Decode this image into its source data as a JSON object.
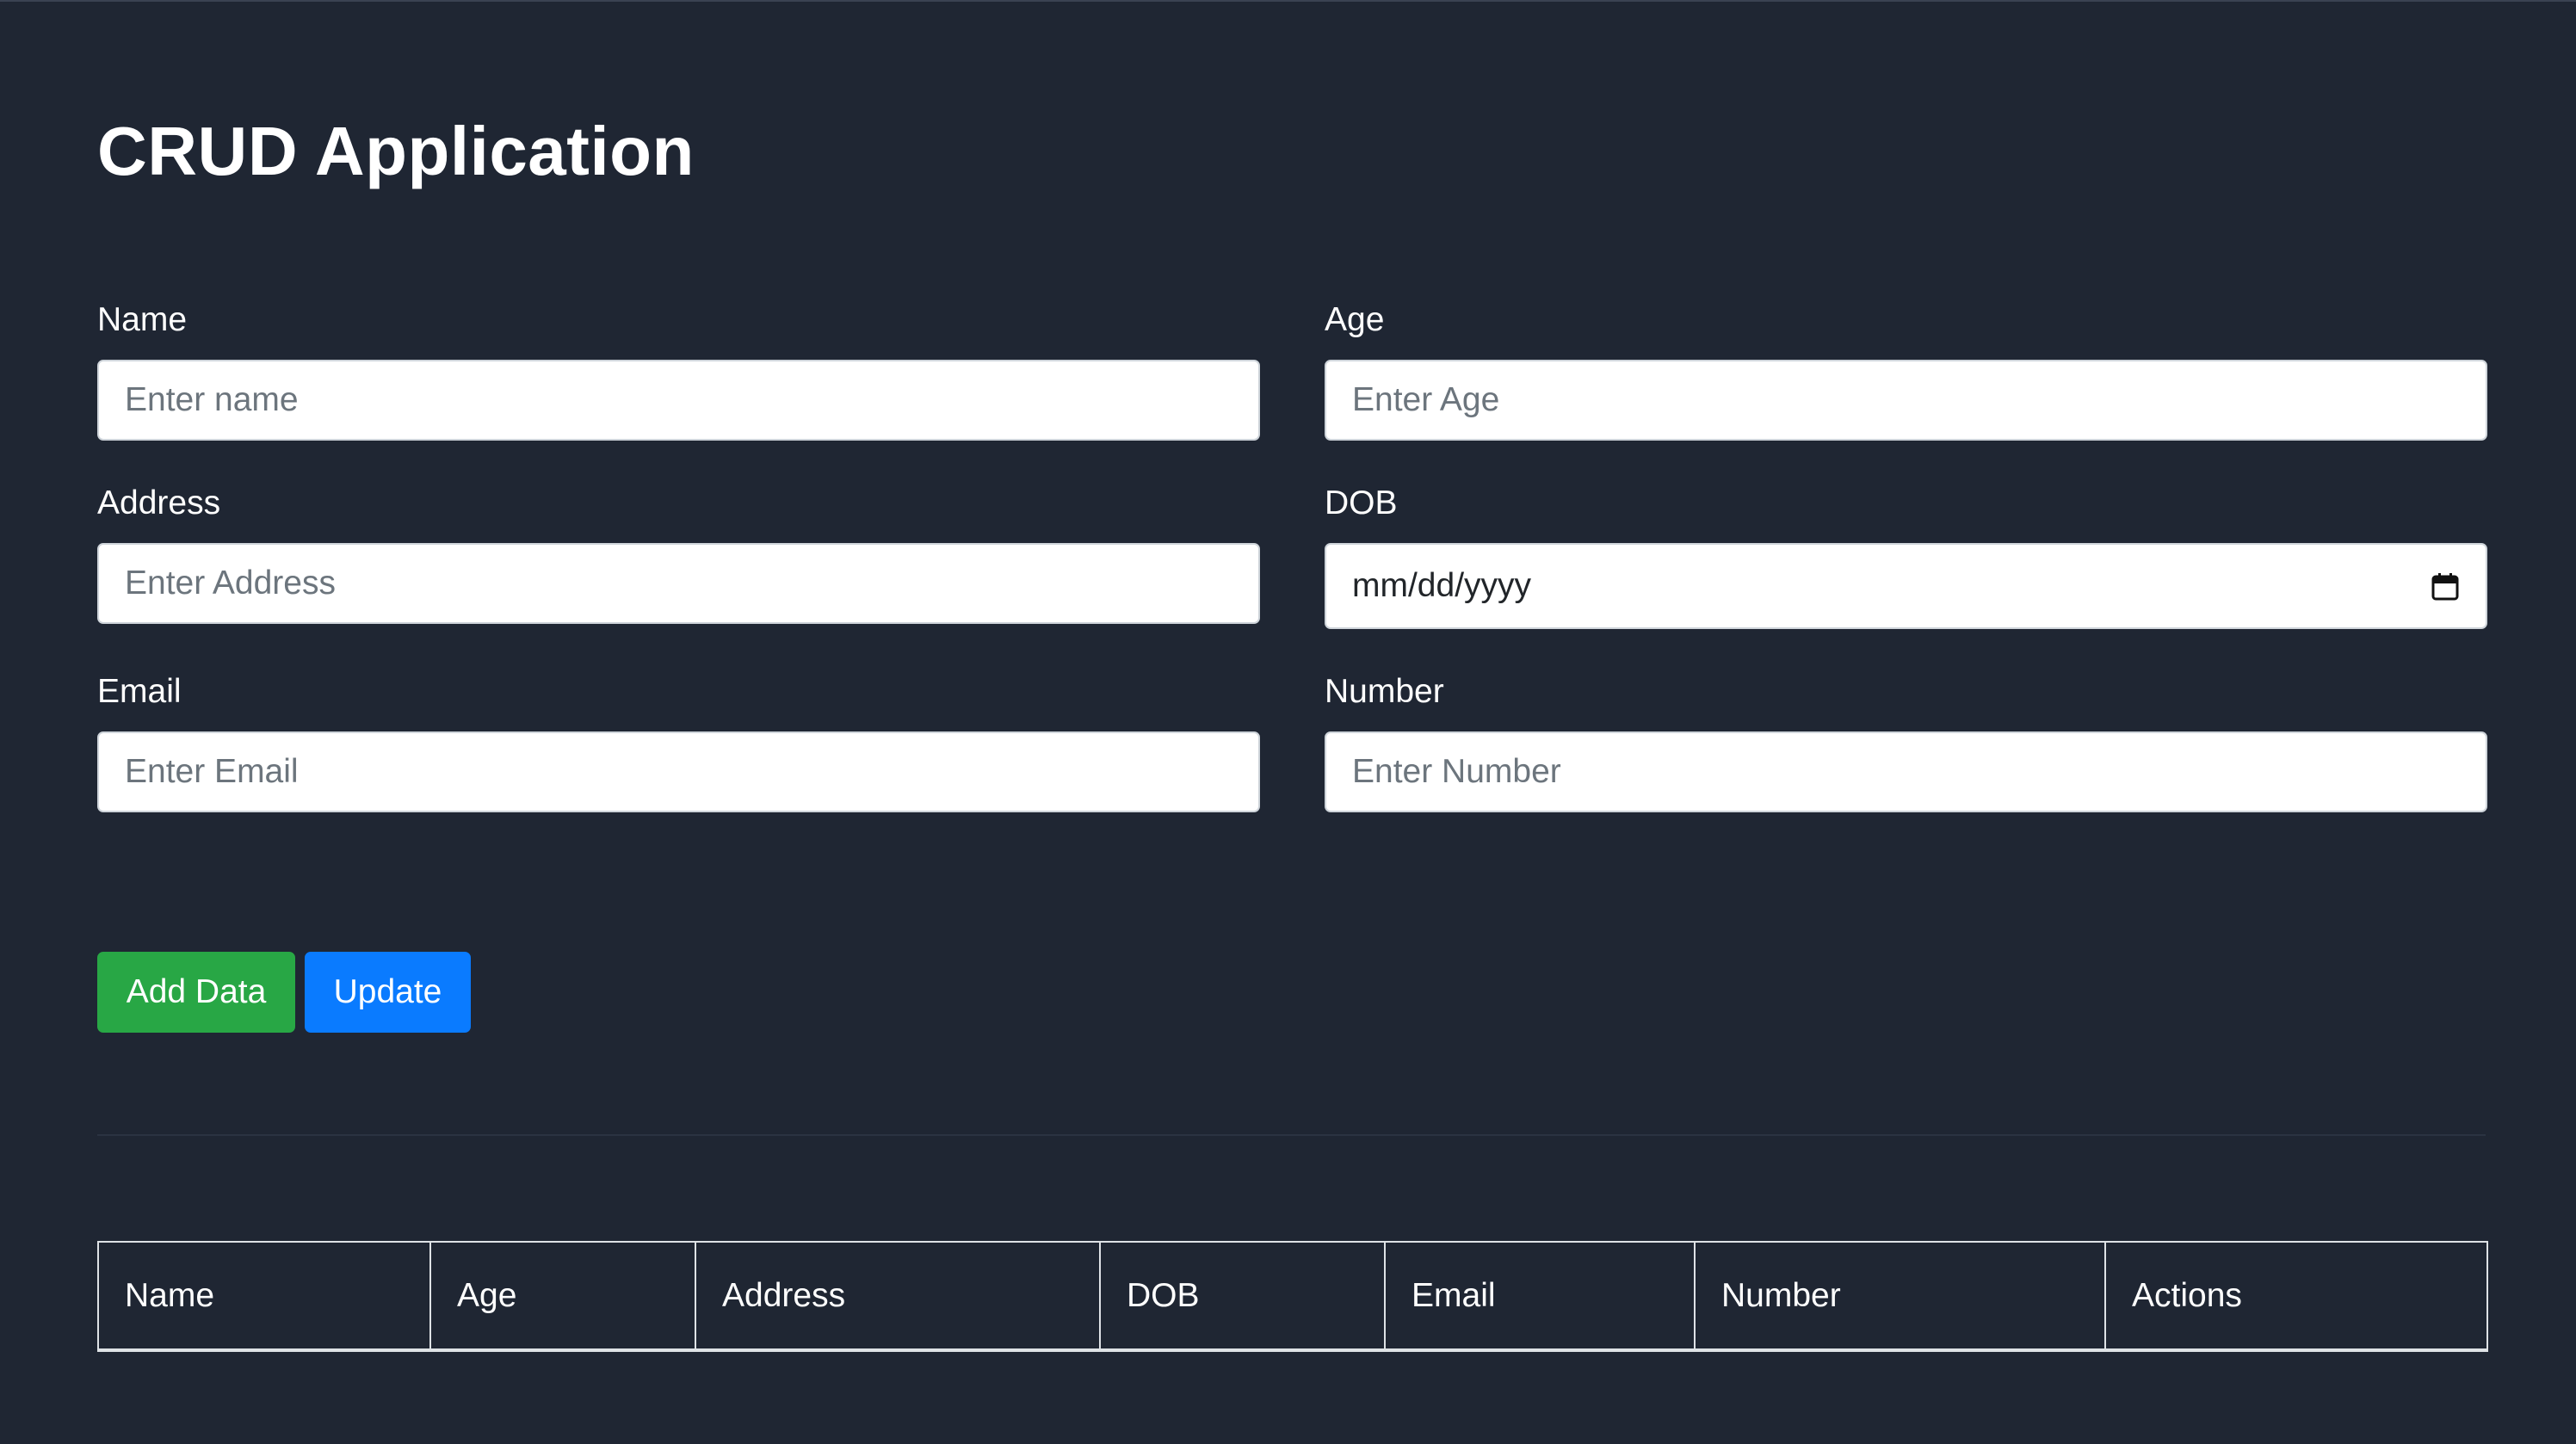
{
  "app": {
    "title": "CRUD Application"
  },
  "form": {
    "name": {
      "label": "Name",
      "placeholder": "Enter name"
    },
    "age": {
      "label": "Age",
      "placeholder": "Enter Age"
    },
    "address": {
      "label": "Address",
      "placeholder": "Enter Address"
    },
    "dob": {
      "label": "DOB",
      "placeholder": "mm/dd/yyyy",
      "icon": "calendar-icon"
    },
    "email": {
      "label": "Email",
      "placeholder": "Enter Email"
    },
    "number": {
      "label": "Number",
      "placeholder": "Enter Number"
    }
  },
  "buttons": {
    "add_label": "Add Data",
    "add_color": "#28a745",
    "update_label": "Update",
    "update_color": "#0a7bff"
  },
  "table": {
    "columns": [
      "Name",
      "Age",
      "Address",
      "DOB",
      "Email",
      "Number",
      "Actions"
    ],
    "rows": []
  },
  "colors": {
    "background": "#1f2633",
    "text": "#ffffff",
    "input_background": "#ffffff",
    "placeholder": "#6c757d"
  }
}
